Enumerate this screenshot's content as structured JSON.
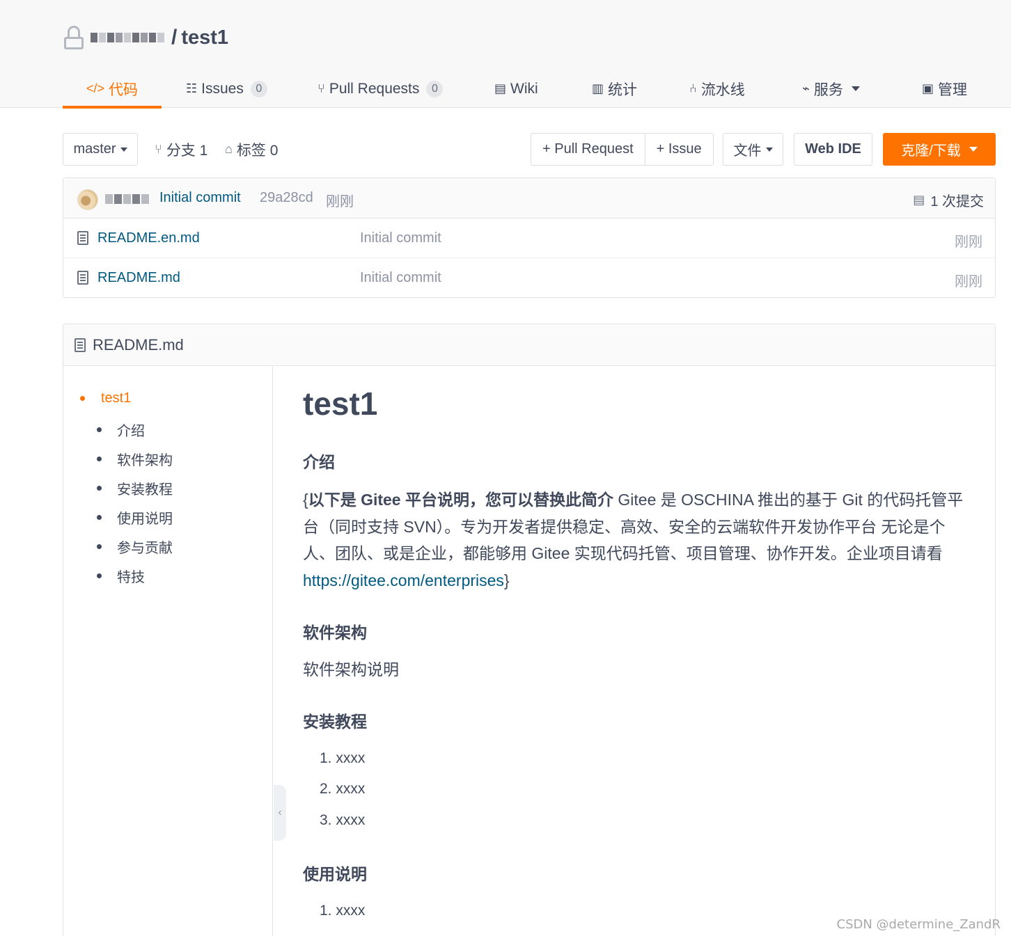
{
  "repo": {
    "owner_redacted": true,
    "separator": "/",
    "name": "test1"
  },
  "tabs": [
    {
      "icon": "code-icon",
      "label": "代码",
      "active": true
    },
    {
      "icon": "issues-icon",
      "label": "Issues",
      "badge": "0"
    },
    {
      "icon": "pull-request-icon",
      "label": "Pull Requests",
      "badge": "0"
    },
    {
      "icon": "wiki-icon",
      "label": "Wiki"
    },
    {
      "icon": "stats-icon",
      "label": "统计"
    },
    {
      "icon": "pipeline-icon",
      "label": "流水线"
    },
    {
      "icon": "pulse-icon",
      "label": "服务"
    },
    {
      "icon": "manage-icon",
      "label": "管理"
    }
  ],
  "toolbar": {
    "branch": "master",
    "branches_label": "分支 1",
    "tags_label": "标签 0",
    "pull_request_btn": "+ Pull Request",
    "issue_btn": "+ Issue",
    "file_btn": "文件",
    "web_ide_btn": "Web IDE",
    "clone_btn": "克隆/下载"
  },
  "last_commit": {
    "message": "Initial commit",
    "sha": "29a28cd",
    "time": "刚刚",
    "count_label": "1 次提交"
  },
  "files": [
    {
      "name": "README.en.md",
      "message": "Initial commit",
      "time": "刚刚"
    },
    {
      "name": "README.md",
      "message": "Initial commit",
      "time": "刚刚"
    }
  ],
  "readme": {
    "filename": "README.md",
    "toc": {
      "top": "test1",
      "items": [
        "介绍",
        "软件架构",
        "安装教程",
        "使用说明",
        "参与贡献",
        "特技"
      ]
    },
    "title": "test1",
    "sections": {
      "intro_heading": "介绍",
      "intro_open": "{",
      "intro_bold": "以下是 Gitee 平台说明，您可以替换此简介",
      "intro_text": " Gitee 是 OSCHINA 推出的基于 Git 的代码托管平台（同时支持 SVN）。专为开发者提供稳定、高效、安全的云端软件开发协作平台 无论是个人、团队、或是企业，都能够用 Gitee 实现代码托管、项目管理、协作开发。企业项目请看 ",
      "intro_link": "https://gitee.com/enterprises",
      "intro_close": "}",
      "arch_heading": "软件架构",
      "arch_text": "软件架构说明",
      "install_heading": "安装教程",
      "install_items": [
        "1. xxxx",
        "2. xxxx",
        "3. xxxx"
      ],
      "usage_heading": "使用说明",
      "usage_items": [
        "1. xxxx"
      ]
    }
  },
  "watermark": "CSDN @determine_ZandR",
  "colors": {
    "accent": "#fe7300",
    "link": "#005980",
    "text": "#40485b",
    "muted": "#8c92a4"
  }
}
